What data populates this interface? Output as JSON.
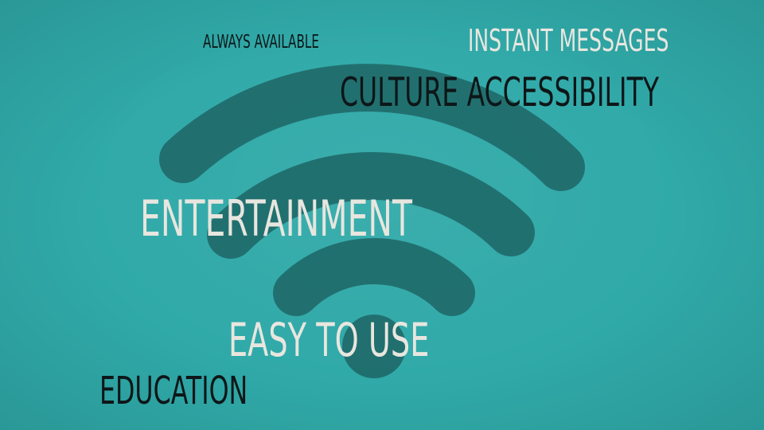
{
  "background_color": "#2fa9a8",
  "icon": {
    "name": "wifi-icon",
    "color": "#1f6a6a"
  },
  "words": {
    "always_available": "ALWAYS AVAILABLE",
    "instant_messages": "INSTANT MESSAGES",
    "culture_accessibility": "CULTURE ACCESSIBILITY",
    "entertainment": "ENTERTAINMENT",
    "easy_to_use": "EASY TO USE",
    "education": "EDUCATION"
  },
  "colors": {
    "dark_text": "#0e1618",
    "light_text": "#e8e6df"
  }
}
